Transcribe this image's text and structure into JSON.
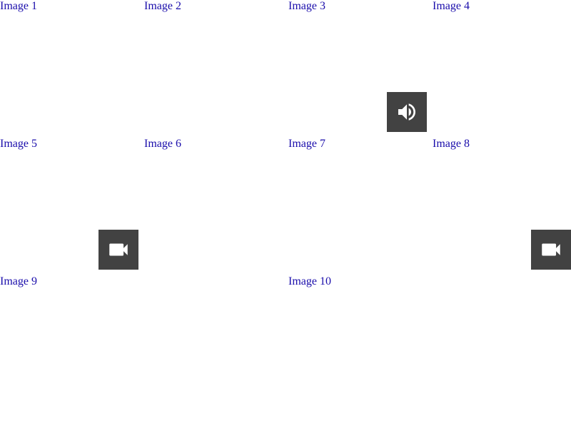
{
  "gallery": {
    "tiles": [
      {
        "alt": "Image 1"
      },
      {
        "alt": "Image 2"
      },
      {
        "alt": "Image 3",
        "badge": "audio"
      },
      {
        "alt": "Image 4"
      },
      {
        "alt": "Image 5",
        "badge": "video"
      },
      {
        "alt": "Image 6"
      },
      {
        "alt": "Image 7"
      },
      {
        "alt": "Image 8",
        "badge": "video"
      },
      {
        "alt": "Image 9"
      },
      {
        "alt": "Image 10"
      }
    ]
  },
  "colors": {
    "badge_bg": "#424242",
    "badge_icon": "#ffffff",
    "alt_text": "#1a0dab"
  },
  "icons": {
    "audio": "speaker-icon",
    "video": "video-camera-icon"
  }
}
